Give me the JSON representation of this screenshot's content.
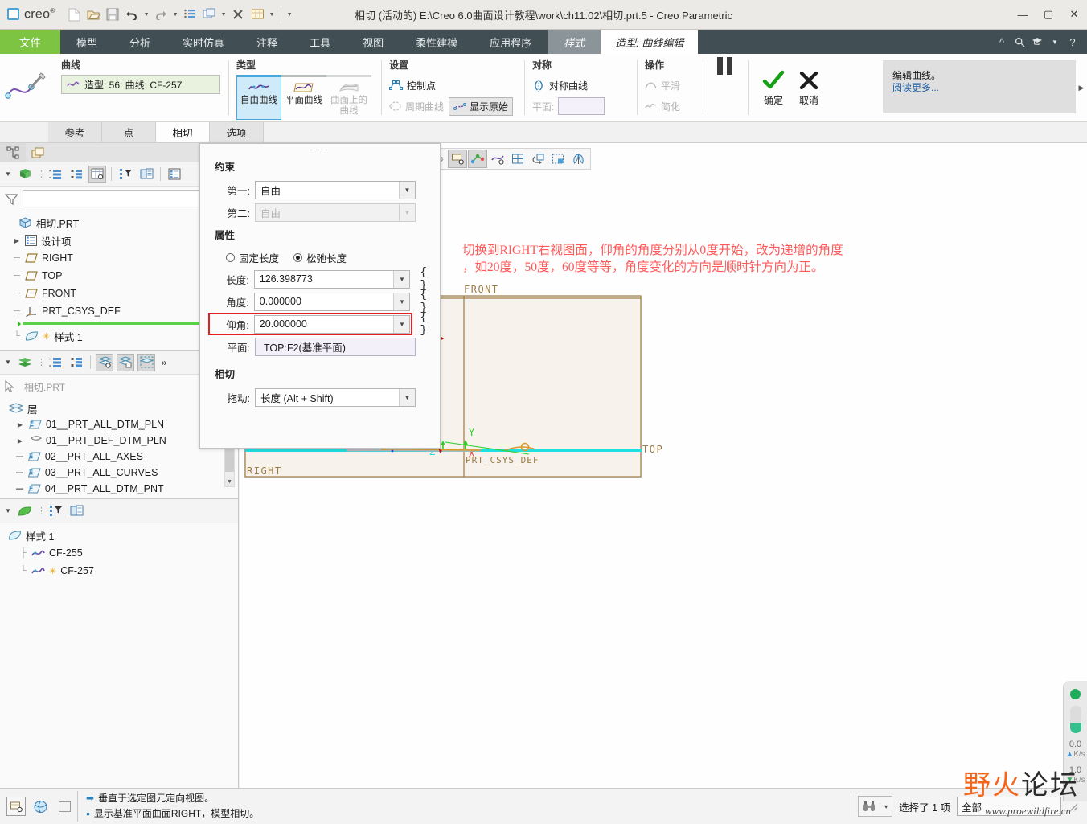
{
  "window": {
    "app_name": "creo",
    "title": "相切 (活动的) E:\\Creo 6.0曲面设计教程\\work\\ch11.02\\相切.prt.5 - Creo Parametric",
    "minimize": "—",
    "maximize": "▢",
    "close": "✕"
  },
  "quick_access": [
    {
      "name": "new-file-icon",
      "label": "新建"
    },
    {
      "name": "open-file-icon",
      "label": "打开"
    },
    {
      "name": "save-icon",
      "label": "保存"
    },
    {
      "name": "undo-icon",
      "label": "撤消"
    },
    {
      "name": "redo-icon",
      "label": "重做"
    },
    {
      "name": "regenerate-icon",
      "label": "重新生成"
    },
    {
      "name": "window-icon",
      "label": "窗口"
    },
    {
      "name": "close-window-icon",
      "label": "关闭"
    },
    {
      "name": "display-style-icon",
      "label": "显示样式"
    }
  ],
  "ribbon_tabs": [
    {
      "id": "file",
      "label": "文件"
    },
    {
      "id": "model",
      "label": "模型"
    },
    {
      "id": "analysis",
      "label": "分析"
    },
    {
      "id": "realtime",
      "label": "实时仿真"
    },
    {
      "id": "annotate",
      "label": "注释"
    },
    {
      "id": "tools",
      "label": "工具"
    },
    {
      "id": "view",
      "label": "视图"
    },
    {
      "id": "flexible",
      "label": "柔性建模"
    },
    {
      "id": "apps",
      "label": "应用程序"
    },
    {
      "id": "style",
      "label": "样式"
    },
    {
      "id": "context",
      "label": "造型: 曲线编辑"
    }
  ],
  "ribbon_right_icons": [
    "collapse-ribbon-icon",
    "search-icon",
    "graduation-icon",
    "chevron-down-icon",
    "help-icon"
  ],
  "ribbon": {
    "curve_group": {
      "header": "曲线",
      "selection": "造型: 56: 曲线: CF-257",
      "selection_icon": "curve-icon"
    },
    "type_group": {
      "header": "类型",
      "buttons": [
        {
          "label": "自由曲线",
          "state": "active",
          "icon": "free-curve-icon"
        },
        {
          "label": "平面曲线",
          "state": "normal",
          "icon": "planar-curve-icon"
        },
        {
          "label": "曲面上的\n曲线",
          "state": "disabled",
          "icon": "cos-curve-icon"
        }
      ]
    },
    "settings_group": {
      "header": "设置",
      "items": [
        {
          "label": "控制点",
          "state": "normal",
          "icon": "control-points-icon"
        },
        {
          "label": "周期曲线",
          "state": "disabled",
          "icon": "periodic-curve-icon"
        },
        {
          "label": "显示原始",
          "state": "toggled",
          "icon": "show-original-icon"
        }
      ]
    },
    "symmetry_group": {
      "header": "对称",
      "checkbox_label": "对称曲线",
      "checkbox_icon": "symmetry-icon",
      "plane_label": "平面:",
      "plane_value": ""
    },
    "operations_group": {
      "header": "操作",
      "items": [
        {
          "label": "平滑",
          "state": "disabled",
          "icon": "smooth-icon"
        },
        {
          "label": "简化",
          "state": "disabled",
          "icon": "simplify-icon"
        }
      ]
    },
    "pause_button": {
      "label": "",
      "icon": "pause-icon"
    },
    "ok_button": {
      "label": "确定",
      "icon": "checkmark-icon"
    },
    "cancel_button": {
      "label": "取消",
      "icon": "x-icon"
    },
    "help_panel": {
      "text": "编辑曲线。",
      "link": "阅读更多...",
      "expand_icon": "chevron-right-icon"
    }
  },
  "dialog_tabs": [
    {
      "label": "参考",
      "active": false
    },
    {
      "label": "点",
      "active": false
    },
    {
      "label": "相切",
      "active": true
    },
    {
      "label": "选项",
      "active": false
    }
  ],
  "navigator": {
    "tabs": [
      {
        "name": "model-tree-tab",
        "active": true
      },
      {
        "name": "layer-tree-tab",
        "active": false
      }
    ],
    "model_tree": {
      "toolbar_icons": [
        "tree-settings-icon",
        "show-icon",
        "more-icon",
        "expand-list-icon",
        "collapse-list-icon",
        "tree-columns-icon",
        "filter-tree-icon",
        "tree-display-icon",
        "design-items-icon"
      ],
      "filter_placeholder": "",
      "filter_value": "",
      "filter_icon": "funnel-icon",
      "filter_clear": "✕",
      "items": [
        {
          "label": "相切.PRT",
          "icon": "part-icon",
          "level": 0,
          "expandable": false
        },
        {
          "label": "设计项",
          "icon": "design-items-icon",
          "level": 1,
          "expandable": true
        },
        {
          "label": "RIGHT",
          "icon": "datum-plane-icon",
          "level": 1,
          "expandable": false
        },
        {
          "label": "TOP",
          "icon": "datum-plane-icon",
          "level": 1,
          "expandable": false
        },
        {
          "label": "FRONT",
          "icon": "datum-plane-icon",
          "level": 1,
          "expandable": false
        },
        {
          "label": "PRT_CSYS_DEF",
          "icon": "csys-icon",
          "level": 1,
          "expandable": false
        },
        {
          "label": "样式 1",
          "icon": "style-feature-icon",
          "level": 1,
          "expandable": false,
          "modified": "✳"
        }
      ]
    },
    "layer_tree": {
      "toolbar_icons": [
        "layer-settings-icon",
        "layers-icon",
        "more-icon",
        "expand-list-icon",
        "collapse-list-icon",
        "layer-show-icon",
        "layer-isolate-icon",
        "layer-select-icon",
        "more-chevron-icon"
      ],
      "pointer_icon": "pointer-icon",
      "part_name": "相切.PRT",
      "root_label": "层",
      "root_icon": "layers-icon",
      "items": [
        {
          "label": "01__PRT_ALL_DTM_PLN",
          "icon": "layer-icon",
          "expandable": true
        },
        {
          "label": "01__PRT_DEF_DTM_PLN",
          "icon": "layer-plane-icon",
          "expandable": true
        },
        {
          "label": "02__PRT_ALL_AXES",
          "icon": "layer-icon",
          "expandable": false
        },
        {
          "label": "03__PRT_ALL_CURVES",
          "icon": "layer-icon",
          "expandable": false
        },
        {
          "label": "04__PRT_ALL_DTM_PNT",
          "icon": "layer-icon",
          "expandable": false
        }
      ]
    },
    "style_tree": {
      "toolbar_icons": [
        "style-settings-icon",
        "style-icon",
        "more-icon",
        "filter-tree-icon",
        "tree-display-icon"
      ],
      "root_label": "样式 1",
      "root_icon": "style-feature-icon",
      "items": [
        {
          "label": "CF-255",
          "icon": "curve-icon",
          "modified": ""
        },
        {
          "label": "CF-257",
          "icon": "curve-icon",
          "modified": "✳"
        }
      ]
    }
  },
  "graphics_toolbar": [
    {
      "name": "refit-icon",
      "state": "disabled"
    },
    {
      "name": "zoom-in-icon",
      "state": "normal"
    },
    {
      "name": "zoom-out-icon",
      "state": "normal"
    },
    {
      "name": "repaint-icon",
      "state": "normal"
    },
    {
      "name": "display-style-icon",
      "state": "normal"
    },
    {
      "name": "saved-orientations-icon",
      "state": "normal"
    },
    {
      "name": "view-manager-icon",
      "state": "normal"
    },
    {
      "name": "perspective-icon",
      "state": "normal"
    },
    {
      "name": "layer-display-icon",
      "state": "normal"
    },
    {
      "name": "datum-display-icon",
      "state": "normal"
    },
    {
      "name": "annotation-display-icon",
      "state": "toggled"
    },
    {
      "name": "spin-center-icon",
      "state": "toggled"
    },
    {
      "name": "datum-points-display-icon",
      "state": "normal"
    },
    {
      "name": "grid-icon",
      "state": "normal"
    },
    {
      "name": "orient-mode-icon",
      "state": "normal"
    },
    {
      "name": "section-icon",
      "state": "normal"
    },
    {
      "name": "style-surface-icon",
      "state": "normal"
    }
  ],
  "viewport": {
    "annotation": "切换到RIGHT右视图面，仰角的角度分别从0度开始，改为递增的角度\n，如20度，50度，60度等等，角度变化的方向是顺时针方向为正。",
    "annotation_color": "#ff5a5a",
    "datum_labels": {
      "front": "FRONT",
      "right": "RIGHT",
      "top": "TOP",
      "csys": "PRT_CSYS_DEF",
      "axis_x": "X",
      "axis_y": "Y",
      "axis_z": "Z"
    }
  },
  "dialog": {
    "constraint_section": "约束",
    "first_label": "第一:",
    "first_value": "自由",
    "second_label": "第二:",
    "second_value": "自由",
    "properties_section": "属性",
    "fixed_length_label": "固定长度",
    "loose_length_label": "松弛长度",
    "length_label": "长度:",
    "length_value": "126.398773",
    "angle_label": "角度:",
    "angle_value": "0.000000",
    "elevation_label": "仰角:",
    "elevation_value": "20.000000",
    "plane_label": "平面:",
    "plane_value": "TOP:F2(基准平面)",
    "tangency_section": "相切",
    "drag_label": "拖动:",
    "drag_value": "长度 (Alt + Shift)",
    "braces": "{ }",
    "highlight_color": "#e62020"
  },
  "status_bar": {
    "left_icons": [
      "datum-display-toggle-icon",
      "spin-center-toggle-icon",
      "blank-panel-icon"
    ],
    "messages": [
      {
        "bullet": "arrow",
        "text": "垂直于选定图元定向视图。"
      },
      {
        "bullet": "dot",
        "text": "显示基准平面曲面RIGHT，模型相切。"
      }
    ],
    "find_icon": "binoculars-icon",
    "find_caret": "▾",
    "selection_text": "选择了 1 项",
    "filter_value": "全部",
    "resize_grip": "resize-grip-icon"
  },
  "watermark": {
    "text_1": "野",
    "text_2": "火",
    "text_3": "论",
    "text_4": "坛",
    "url": "www.proewildfire.cn"
  },
  "net_meter": {
    "upload": "0.0",
    "upload_unit": "K/s",
    "download": "1.0",
    "download_unit": "K/s"
  }
}
